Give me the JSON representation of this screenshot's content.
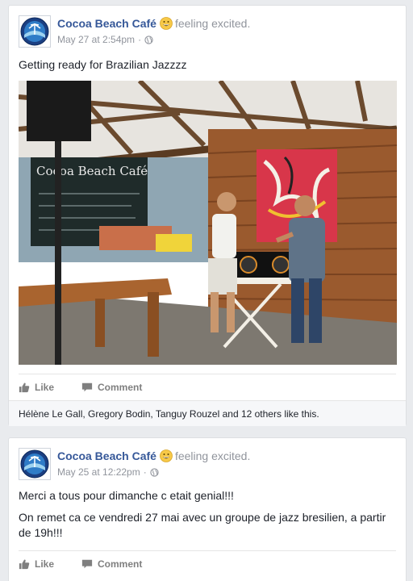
{
  "posts": [
    {
      "author": "Cocoa Beach Café",
      "feeling": "feeling excited.",
      "timestamp": "May 27 at 2:54pm",
      "separator": "·",
      "text": [
        "Getting ready for Brazilian Jazzzz"
      ],
      "photo": {
        "sign_text": "Cocoa Beach Café"
      },
      "actions": {
        "like": "Like",
        "comment": "Comment"
      },
      "likes_summary": "Hélène Le Gall, Gregory Bodin, Tanguy Rouzel and 12 others like this."
    },
    {
      "author": "Cocoa Beach Café",
      "feeling": "feeling excited.",
      "timestamp": "May 25 at 12:22pm",
      "separator": "·",
      "text": [
        "Merci a tous pour dimanche c etait genial!!!",
        "On remet ca ce vendredi 27 mai avec un groupe de jazz bresilien, a partir de 19h!!!"
      ],
      "actions": {
        "like": "Like",
        "comment": "Comment"
      }
    }
  ],
  "icons": {
    "avatar": "cocoa-beach-logo",
    "feeling": "grinning-emoji",
    "privacy": "globe-icon",
    "like": "thumbs-up-icon",
    "comment": "comment-bubble-icon"
  },
  "colors": {
    "link": "#365899",
    "meta": "#90949c",
    "background": "#e9ebee"
  }
}
